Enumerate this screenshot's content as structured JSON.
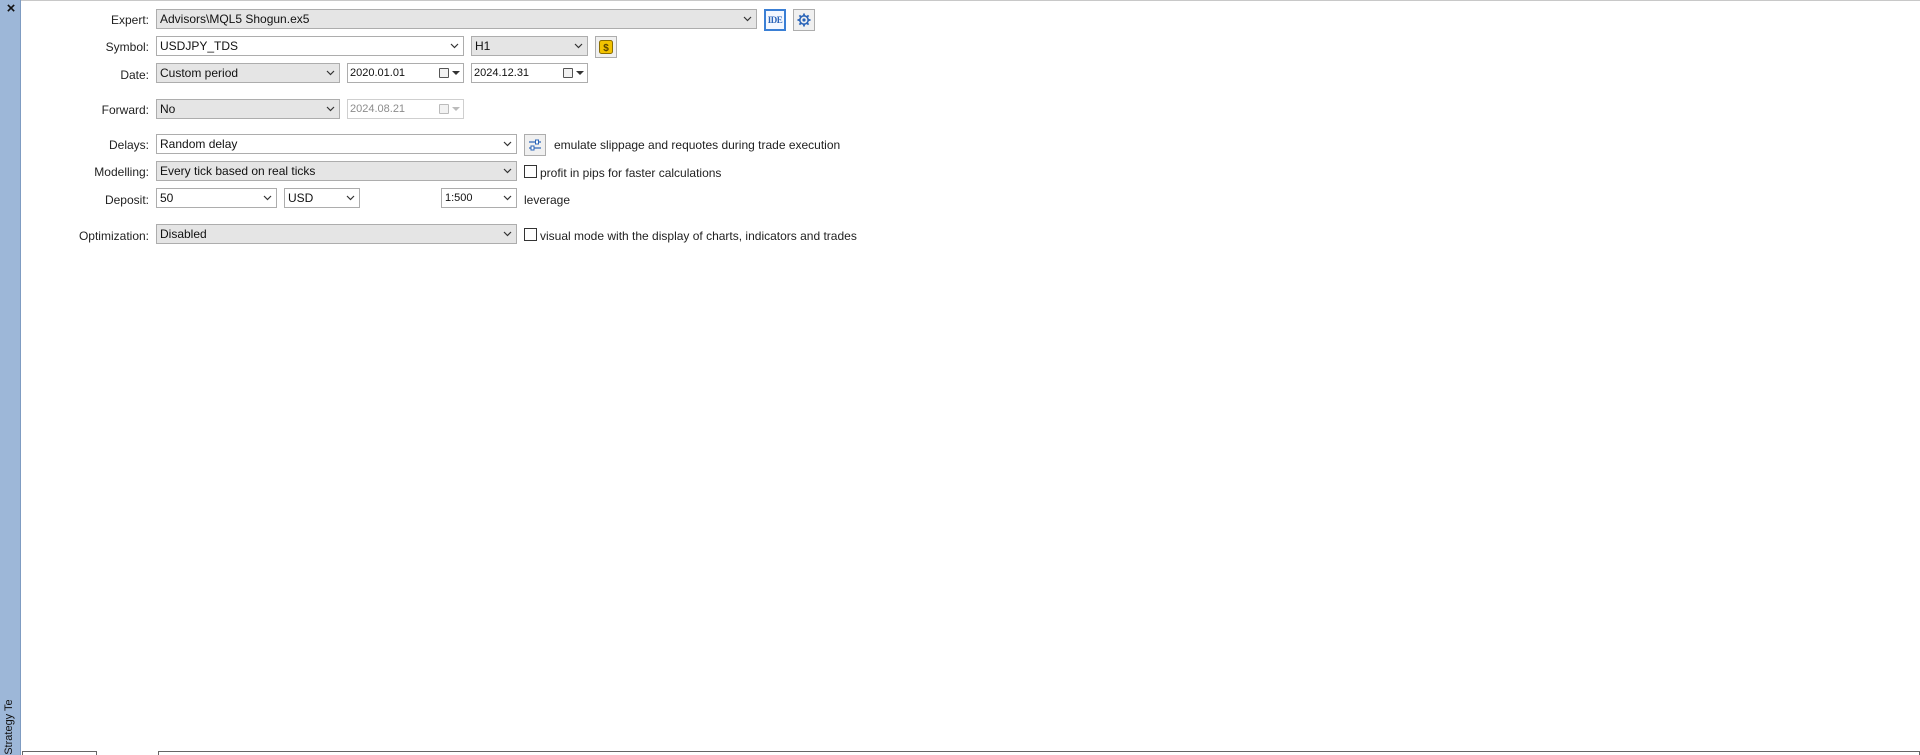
{
  "panel": {
    "close_symbol": "×",
    "title": "Strategy Tester"
  },
  "expert": {
    "label": "Expert:",
    "value": "Advisors\\MQL5 Shogun.ex5",
    "ide_button": "IDE"
  },
  "symbol": {
    "label": "Symbol:",
    "value": "USDJPY_TDS",
    "timeframe": "H1"
  },
  "date": {
    "label": "Date:",
    "period": "Custom period",
    "from": "2020.01.01",
    "to": "2024.12.31"
  },
  "forward": {
    "label": "Forward:",
    "value": "No",
    "date": "2024.08.21"
  },
  "delays": {
    "label": "Delays:",
    "value": "Random delay",
    "description": "emulate slippage and requotes during trade execution"
  },
  "modelling": {
    "label": "Modelling:",
    "value": "Every tick based on real ticks",
    "checkbox_label": "profit in pips for faster calculations",
    "checked": false
  },
  "deposit": {
    "label": "Deposit:",
    "amount": "50",
    "currency": "USD",
    "leverage": "1:500",
    "leverage_label": "leverage"
  },
  "optimization": {
    "label": "Optimization:",
    "value": "Disabled",
    "checkbox_label": "visual mode with the display of charts, indicators and trades",
    "checked": false
  },
  "colors": {
    "sidebar": "#9db7d8",
    "accent": "#3a7fd5",
    "symbol_badge": "#f2c200"
  }
}
